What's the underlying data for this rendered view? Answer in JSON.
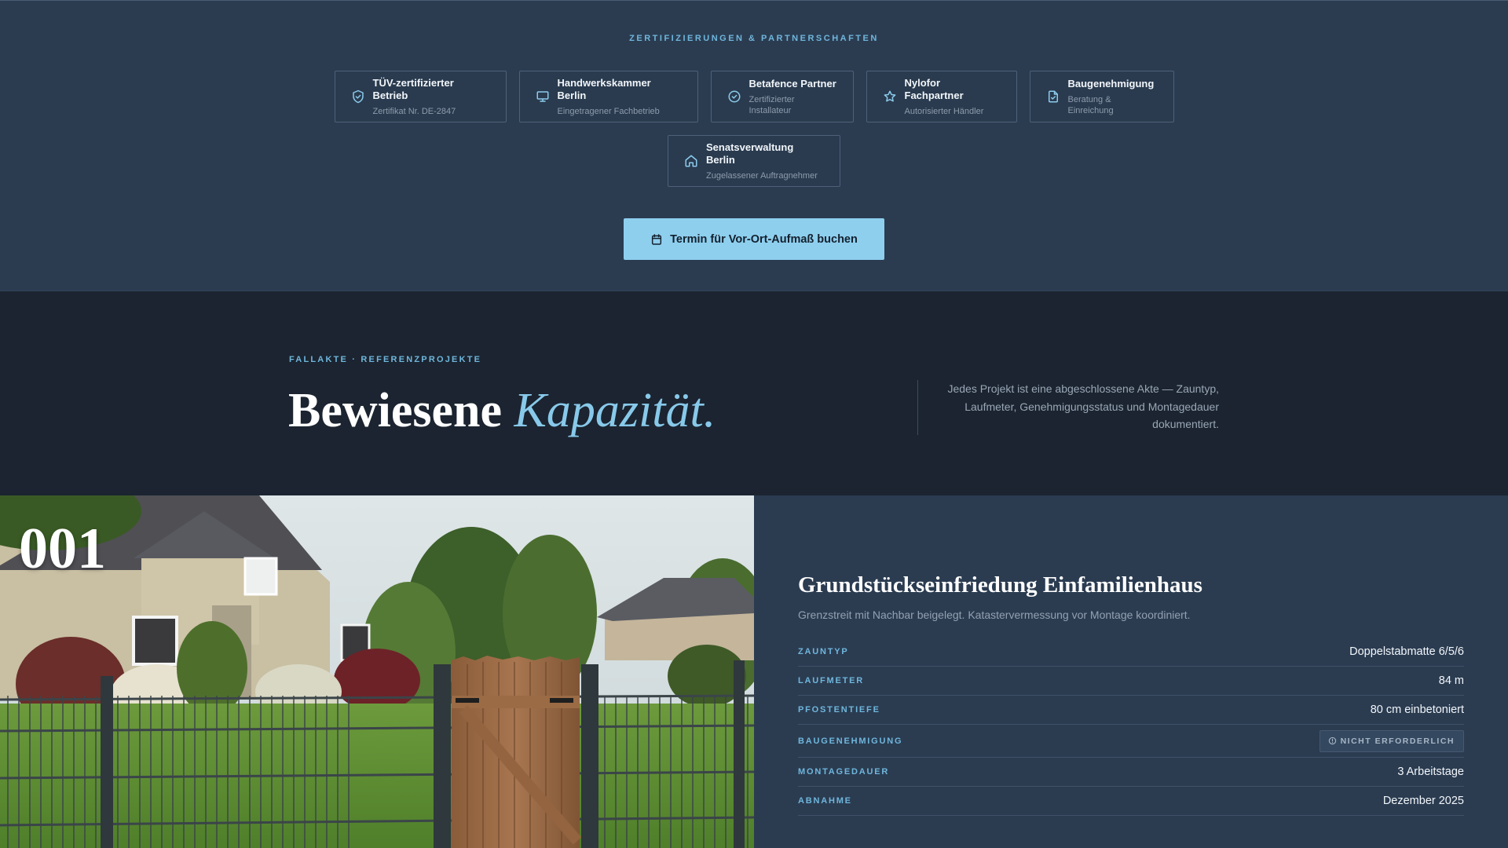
{
  "certifications": {
    "eyebrow": "ZERTIFIZIERUNGEN & PARTNERSCHAFTEN",
    "items": [
      {
        "icon": "shield-check-icon",
        "title": "TÜV-zertifizierter Betrieb",
        "subtitle": "Zertifikat Nr. DE-2847"
      },
      {
        "icon": "monitor-icon",
        "title": "Handwerkskammer Berlin",
        "subtitle": "Eingetragener Fachbetrieb"
      },
      {
        "icon": "check-circle-icon",
        "title": "Betafence Partner",
        "subtitle": "Zertifizierter Installateur"
      },
      {
        "icon": "star-icon",
        "title": "Nylofor Fachpartner",
        "subtitle": "Autorisierter Händler"
      },
      {
        "icon": "document-check-icon",
        "title": "Baugenehmigung",
        "subtitle": "Beratung & Einreichung"
      },
      {
        "icon": "home-icon",
        "title": "Senatsverwaltung Berlin",
        "subtitle": "Zugelassener Auftragnehmer"
      }
    ],
    "cta": {
      "icon": "calendar-icon",
      "label": "Termin für Vor-Ort-Aufmaß buchen"
    }
  },
  "intro": {
    "eyebrow": "FALLAKTE · REFERENZPROJEKTE",
    "headline_main": "Bewiesene ",
    "headline_accent": "Kapazität.",
    "description": "Jedes Projekt ist eine abgeschlossene Akte — Zauntyp, Laufmeter, Genehmigungsstatus und Montagedauer dokumentiert."
  },
  "project": {
    "number": "001",
    "title": "Grundstückseinfriedung Einfamilienhaus",
    "subtitle": "Grenzstreit mit Nachbar beigelegt. Katastervermessung vor Montage koordiniert.",
    "specs": [
      {
        "label": "ZAUNTYP",
        "value": "Doppelstabmatte 6/5/6"
      },
      {
        "label": "LAUFMETER",
        "value": "84 m"
      },
      {
        "label": "PFOSTENTIEFE",
        "value": "80 cm einbetoniert"
      },
      {
        "label": "BAUGENEHMIGUNG",
        "value": "NICHT ERFORDERLICH",
        "badge_icon": "info-circle-icon"
      },
      {
        "label": "MONTAGEDAUER",
        "value": "3 Arbeitstage"
      },
      {
        "label": "ABNAHME",
        "value": "Dezember 2025"
      }
    ]
  },
  "colors": {
    "accent": "#8ecfee",
    "eyebrow": "#6fb6dc",
    "panel": "#2b3c51",
    "dark": "#1b2430"
  }
}
